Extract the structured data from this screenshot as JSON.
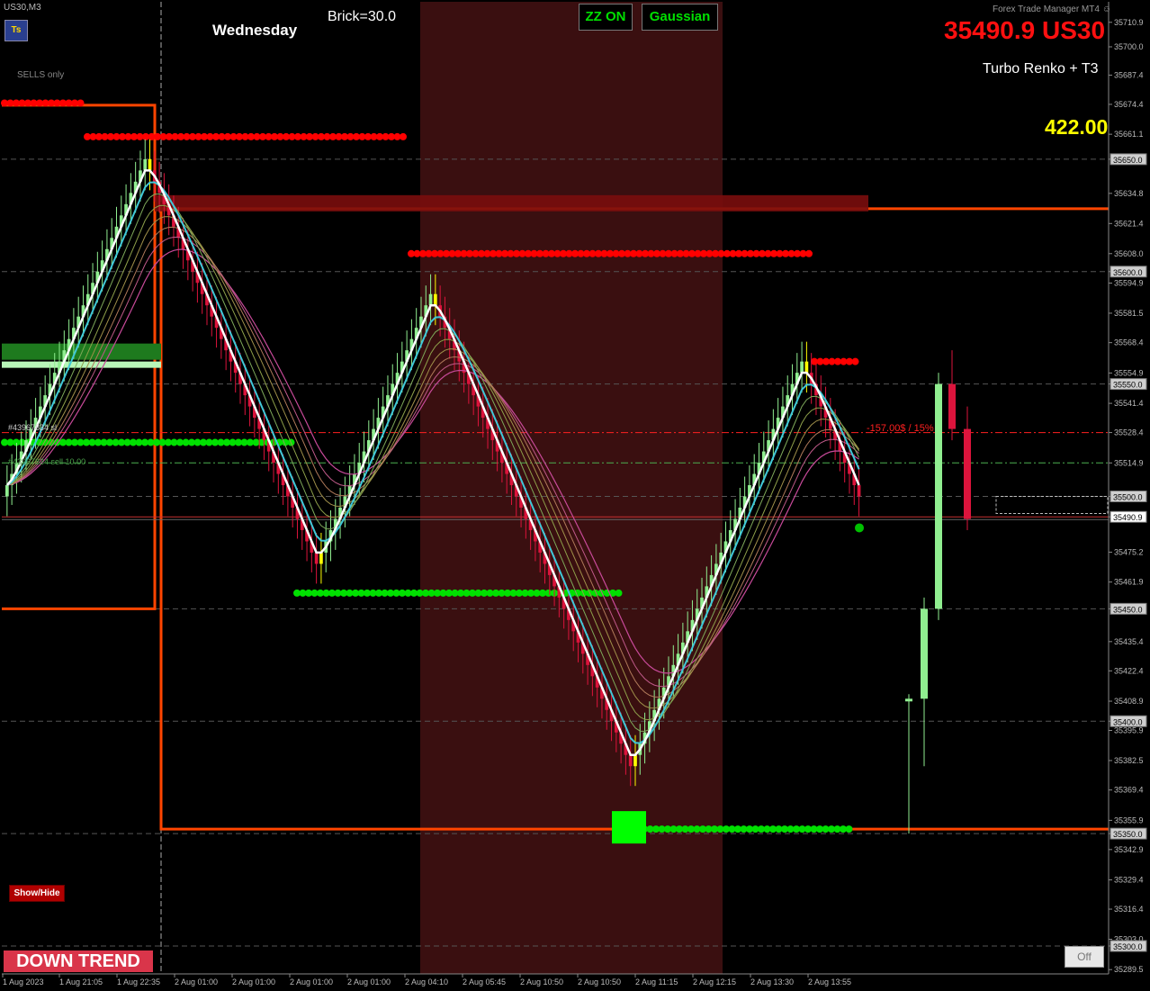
{
  "window": {
    "title": "US30,M3"
  },
  "logo": "Ts",
  "ui": {
    "sells_only": "SELLS only",
    "weekday": "Wednesday",
    "brick": "Brick=30.0",
    "zz_button": "ZZ ON",
    "gaussian_button": "Gaussian",
    "ftm_label": "Forex Trade Manager MT4",
    "price_display": "35490.9 US30",
    "chart_mode": "Turbo Renko + T3",
    "pnl_value": "422.00",
    "order_label_1": "#43967834 sl",
    "order_label_2": "#43967834 sell 10.00",
    "tp_label": "-157.00$ / 15%",
    "show_hide": "Show/Hide",
    "trend_badge": "DOWN TREND",
    "off_button": "Off"
  },
  "colors": {
    "bull": "#90ee90",
    "bear": "#dc143c",
    "reversal": "#ffff00",
    "resistance_dots": "#ff0000",
    "support_dots": "#00e000",
    "box": "#ff4500",
    "session_shade": "#3a0f10",
    "t3_line": "#ffffff",
    "fast_ma": "#40c8d8"
  },
  "chart_data": {
    "type": "candlestick",
    "symbol": "US30",
    "timeframe": "M3",
    "ylim": [
      35282.5,
      35720.5
    ],
    "price_ticks": [
      "35710.9",
      "35700.0",
      "35687.4",
      "35674.4",
      "35661.1",
      "35650.0",
      "35634.8",
      "35621.4",
      "35608.0",
      "35600.0",
      "35594.9",
      "35581.5",
      "35568.4",
      "35554.9",
      "35550.0",
      "35541.4",
      "35528.4",
      "35514.9",
      "35500.0",
      "35490.9",
      "35475.2",
      "35461.9",
      "35450.0",
      "35435.4",
      "35422.4",
      "35408.9",
      "35400.0",
      "35395.9",
      "35382.5",
      "35369.4",
      "35355.9",
      "35350.0",
      "35342.9",
      "35329.4",
      "35316.4",
      "35303.0",
      "35300.0",
      "35289.5"
    ],
    "boxed_levels": [
      "35650.0",
      "35600.0",
      "35550.0",
      "35500.0",
      "35490.9",
      "35450.0",
      "35400.0",
      "35350.0",
      "35300.0"
    ],
    "time_ticks": [
      "1 Aug 2023",
      "1 Aug 21:05",
      "1 Aug 22:35",
      "2 Aug 01:00",
      "2 Aug 01:00",
      "2 Aug 01:00",
      "2 Aug 01:00",
      "2 Aug 04:10",
      "2 Aug 05:45",
      "2 Aug 10:50",
      "2 Aug 10:50",
      "2 Aug 11:15",
      "2 Aug 12:15",
      "2 Aug 13:30",
      "2 Aug 13:55"
    ],
    "renko_path": [
      35500,
      35530,
      35560,
      35590,
      35620,
      35650,
      35620,
      35590,
      35560,
      35530,
      35500,
      35470,
      35500,
      35530,
      35560,
      35590,
      35560,
      35530,
      35500,
      35470,
      35440,
      35410,
      35380,
      35410,
      35440,
      35470,
      35500,
      35530,
      35560,
      35530,
      35500
    ],
    "big_candles": [
      {
        "open": 35410,
        "close": 35410,
        "high": 35412,
        "low": 35350
      },
      {
        "open": 35410,
        "close": 35450,
        "high": 35455,
        "low": 35380
      },
      {
        "open": 35450,
        "close": 35550,
        "high": 35555,
        "low": 35445
      },
      {
        "open": 35550,
        "close": 35530,
        "high": 35565,
        "low": 35525
      },
      {
        "open": 35530,
        "close": 35490,
        "high": 35540,
        "low": 35485
      }
    ],
    "current_price": 35490.9,
    "resistance_levels": [
      35675,
      35660,
      35610,
      35560
    ],
    "support_levels": [
      35525,
      35460,
      35352
    ],
    "order_levels": {
      "sl": 35528.4,
      "entry": 35514.9,
      "take_profit_dashed": 35528.4
    },
    "box_top": 35628,
    "box_bottom": 35352
  }
}
